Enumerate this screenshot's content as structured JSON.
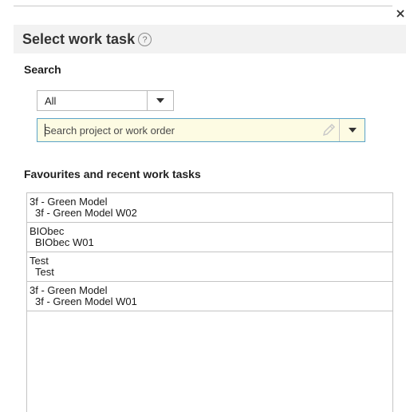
{
  "dialog": {
    "title": "Select work task",
    "help_icon": "question-circle-icon",
    "close_icon": "close-icon"
  },
  "search": {
    "label": "Search",
    "scope_value": "All",
    "placeholder": "Search project or work order"
  },
  "favourites": {
    "label": "Favourites and recent work tasks",
    "items": [
      {
        "project": "3f - Green Model",
        "work_order": "3f - Green Model W02"
      },
      {
        "project": "BIObec",
        "work_order": "BIObec W01"
      },
      {
        "project": "Test",
        "work_order": "Test"
      },
      {
        "project": "3f - Green Model",
        "work_order": "3f - Green Model W01"
      }
    ]
  }
}
